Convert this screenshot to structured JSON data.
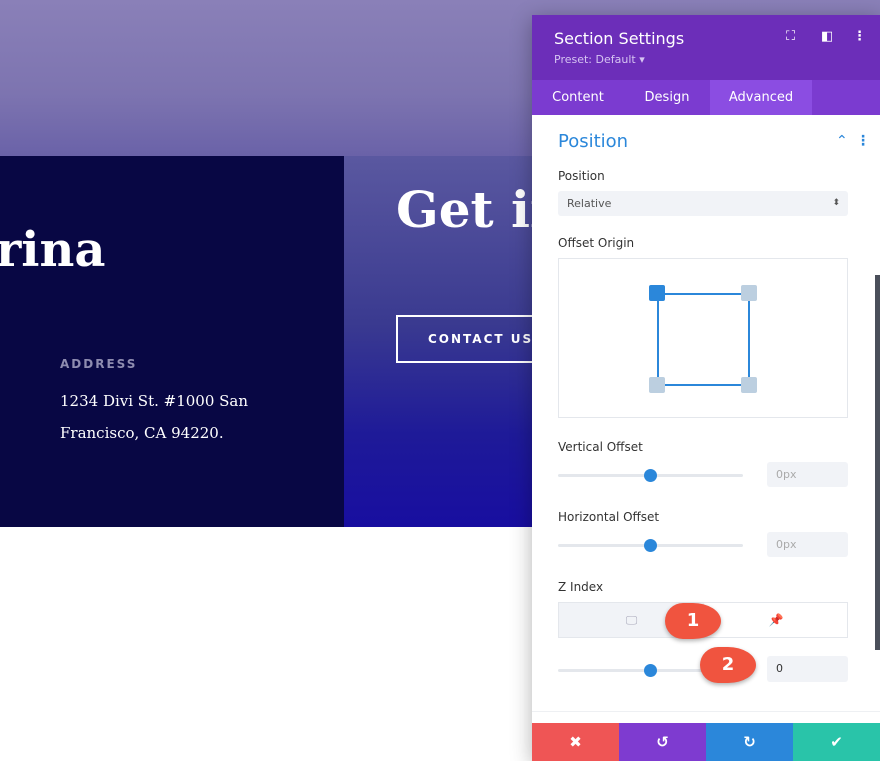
{
  "page": {
    "title_fragment": "rina",
    "address_label": "ADDRESS",
    "address_line1": "1234 Divi St. #1000 San",
    "address_line2": "Francisco, CA 94220.",
    "heading": "Get in touch",
    "contact_button": "CONTACT US"
  },
  "panel": {
    "title": "Section Settings",
    "preset": "Preset: Default ▾",
    "tabs": [
      {
        "label": "Content"
      },
      {
        "label": "Design"
      },
      {
        "label": "Advanced",
        "active": true
      }
    ],
    "section_title": "Position",
    "position": {
      "label": "Position",
      "value": "Relative"
    },
    "offset_origin": {
      "label": "Offset Origin",
      "selected": "top-left"
    },
    "vertical_offset": {
      "label": "Vertical Offset",
      "value": "0px",
      "slider": 50
    },
    "horizontal_offset": {
      "label": "Horizontal Offset",
      "value": "0px",
      "slider": 50
    },
    "z_index": {
      "label": "Z Index",
      "value": "0",
      "slider": 50
    },
    "annotations": [
      "1",
      "2"
    ],
    "colors": {
      "header": "#6c2eb9",
      "tabs": "#7b3bd0",
      "accent": "#2b87da",
      "cancel": "#ef5555",
      "undo": "#7e3bd0",
      "redo": "#2b87da",
      "save": "#29c4a9"
    }
  }
}
